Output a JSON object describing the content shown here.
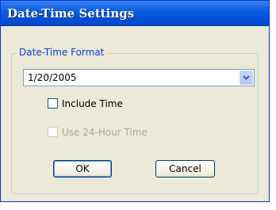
{
  "window": {
    "title": "Date-Time Settings"
  },
  "group": {
    "label": "Date-Time Format"
  },
  "format_select": {
    "value": "1/20/2005"
  },
  "include_time": {
    "label": "Include Time",
    "checked": false
  },
  "use_24h": {
    "label": "Use 24-Hour Time",
    "checked": false,
    "disabled": true
  },
  "buttons": {
    "ok": "OK",
    "cancel": "Cancel"
  },
  "colors": {
    "titlebar": "#0a5fde",
    "dialog_bg": "#ece9d8",
    "group_label": "#0046d5",
    "disabled_text": "#aca899"
  }
}
